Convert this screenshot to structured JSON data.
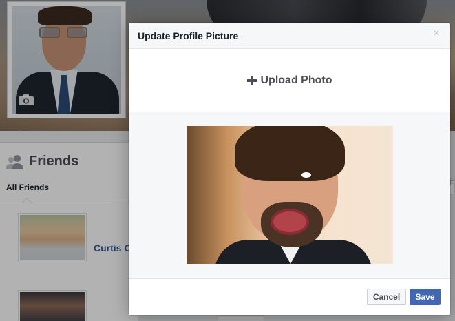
{
  "background": {
    "friends": {
      "title": "Friends",
      "tab_label": "All Friends",
      "friend_name": "Curtis C",
      "edge_letter": "F"
    }
  },
  "dialog": {
    "title": "Update Profile Picture",
    "close_glyph": "×",
    "upload_label": "Upload Photo",
    "cancel_label": "Cancel",
    "save_label": "Save"
  },
  "icons": {
    "close": "close-icon",
    "plus": "plus-icon",
    "camera": "camera-icon",
    "friends": "friends-icon"
  },
  "colors": {
    "primary_button": "#4267b2",
    "link": "#365899",
    "text_dark": "#1d2129",
    "text_muted": "#4b4f56",
    "overlay": "rgba(0,0,0,0.30)"
  }
}
